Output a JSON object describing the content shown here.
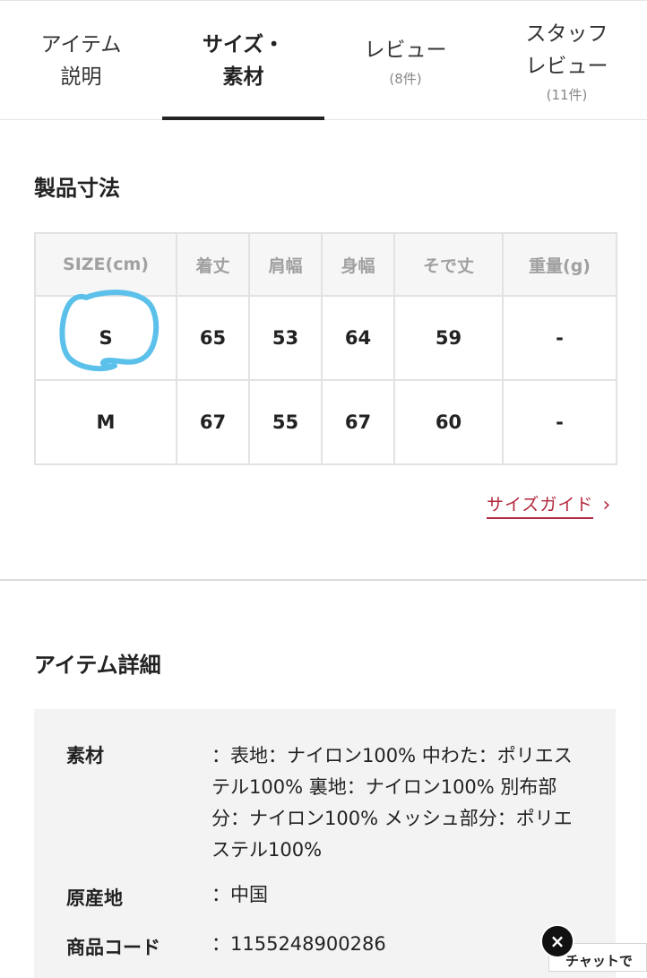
{
  "tabs": [
    {
      "label": "アイテム\n説明",
      "count": ""
    },
    {
      "label": "サイズ・\n素材",
      "count": ""
    },
    {
      "label": "レビュー",
      "count": "(8件)"
    },
    {
      "label": "スタッフ\nレビュー",
      "count": "(11件)"
    }
  ],
  "active_tab": 1,
  "size_section": {
    "title": "製品寸法",
    "headers": [
      "SIZE(cm)",
      "着丈",
      "肩幅",
      "身幅",
      "そで丈",
      "重量(g)"
    ],
    "rows": [
      [
        "S",
        "65",
        "53",
        "64",
        "59",
        "-"
      ],
      [
        "M",
        "67",
        "55",
        "67",
        "60",
        "-"
      ]
    ],
    "highlight_color": "#5bc0ea",
    "guide_link": "サイズガイド",
    "guide_chevron": "›"
  },
  "detail_section": {
    "title": "アイテム詳細",
    "rows": [
      {
        "label": "素材",
        "value": "：表地：ナイロン100% 中わた：ポリエステル100% 裏地：ナイロン100% 別布部分：ナイロン100% メッシュ部分：ポリエステル100%"
      },
      {
        "label": "原産地",
        "value": "：中国"
      },
      {
        "label": "商品コード",
        "value": "：1155248900286"
      }
    ]
  },
  "chat": {
    "close_icon": "×",
    "label": "チャットで"
  },
  "colors": {
    "accent": "#b3263b",
    "table_border": "#e2e2e2",
    "header_bg": "#f6f6f6",
    "detail_bg": "#f3f3f3"
  }
}
